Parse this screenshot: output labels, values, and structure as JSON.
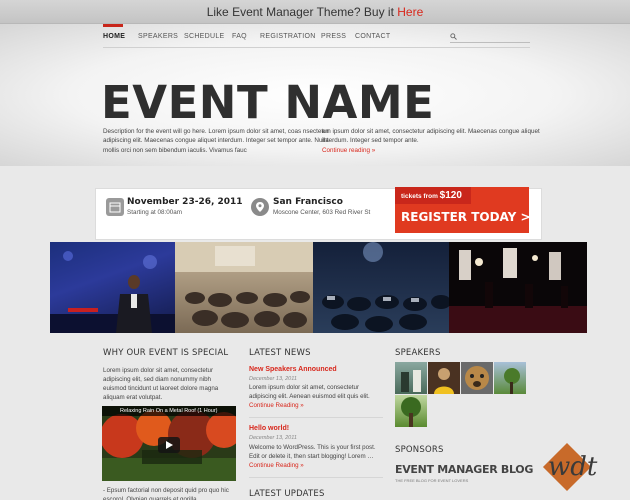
{
  "promo": {
    "text": "Like Event Manager Theme? Buy it ",
    "link": "Here"
  },
  "nav": {
    "items": [
      "HOME",
      "SPEAKERS",
      "SCHEDULE",
      "FAQ",
      "REGISTRATION",
      "PRESS",
      "CONTACT"
    ],
    "active": "HOME",
    "search_icon": "search-icon"
  },
  "hero": {
    "title": "EVENT NAME",
    "desc_left": "Description for the event will go here. Lorem ipsum dolor sit amet, coas nsectetur adipiscing elit. Maecenas congue aliquet interdum. Integer set tempor ante. Nulla mollis orci non sem bibendum iaculis. Vivamus fauc",
    "desc_right": "em ipsum dolor sit amet, consectetur adipiscing elit. Maecenas congue aliquet interdum. Integer sed tempor ante.",
    "continue": "Continue reading »"
  },
  "info": {
    "date": "November 23-26, 2011",
    "time": "Starting at 08:00am",
    "city": "San Francisco",
    "venue": "Moscone Center, 603 Red River St",
    "tickets_prefix": "tickets from ",
    "tickets_price": "$120",
    "register_label": "REGISTER TODAY >",
    "calendar_icon": "calendar-icon",
    "location_icon": "map-pin-icon"
  },
  "why": {
    "heading": "WHY OUR EVENT IS SPECIAL",
    "text": "Lorem ipsum dolor sit amet, consectetur adipiscing elit, sed diam nonummy nibh euismod tincidunt ut laoreet dolore magna aliquam erat volutpat.",
    "video_title": "Relaxing Rain On a Metal Roof (1 Hour)",
    "footer_text": "- Epsum factorial non deposit quid pro quo hic escorol. Olypian quarrels et gorilla"
  },
  "news": {
    "heading": "LATEST NEWS",
    "items": [
      {
        "title": "New Speakers Announced",
        "date": "December 13, 2011",
        "text": "Lorem ipsum dolor sit amet, consectetur adipiscing elit. Aenean euismod elit quis elit.",
        "more": "Continue Reading »"
      },
      {
        "title": "Hello world!",
        "date": "December 13, 2011",
        "text": "Welcome to WordPress. This is your first post. Edit or delete it, then start blogging! Lorem … ",
        "more": "Continue Reading »"
      }
    ],
    "next_heading": "LATEST UPDATES"
  },
  "speakers": {
    "heading": "SPEAKERS"
  },
  "sponsors": {
    "heading": "SPONSORS",
    "blog_name": "EVENT MANAGER BLOG",
    "blog_tagline": "THE FREE BLOG FOR EVENT LOVERS",
    "logo_text": "wdt"
  },
  "colors": {
    "accent": "#d8271c",
    "register": "#e03a20"
  }
}
